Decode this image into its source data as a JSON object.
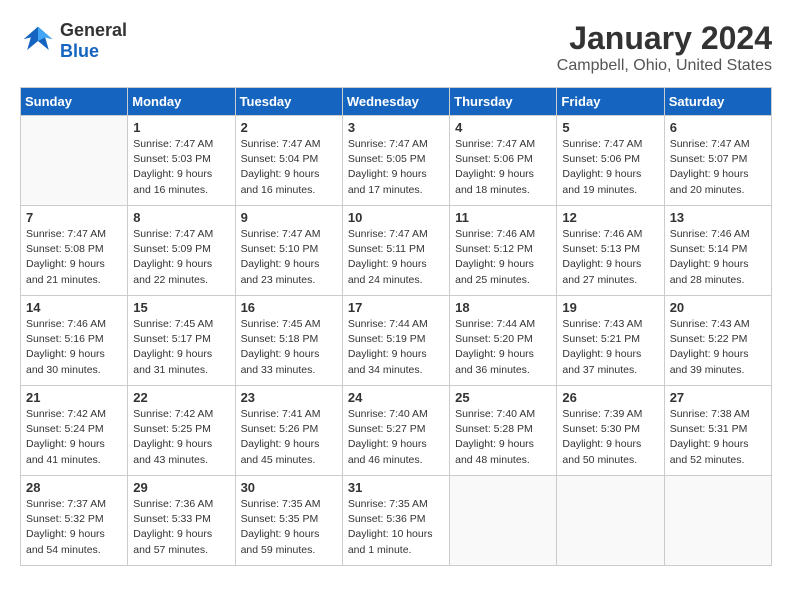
{
  "logo": {
    "line1": "General",
    "line2": "Blue"
  },
  "title": "January 2024",
  "location": "Campbell, Ohio, United States",
  "days_header": [
    "Sunday",
    "Monday",
    "Tuesday",
    "Wednesday",
    "Thursday",
    "Friday",
    "Saturday"
  ],
  "weeks": [
    [
      {
        "day": "",
        "sunrise": "",
        "sunset": "",
        "daylight": ""
      },
      {
        "day": "1",
        "sunrise": "7:47 AM",
        "sunset": "5:03 PM",
        "daylight": "9 hours and 16 minutes."
      },
      {
        "day": "2",
        "sunrise": "7:47 AM",
        "sunset": "5:04 PM",
        "daylight": "9 hours and 16 minutes."
      },
      {
        "day": "3",
        "sunrise": "7:47 AM",
        "sunset": "5:05 PM",
        "daylight": "9 hours and 17 minutes."
      },
      {
        "day": "4",
        "sunrise": "7:47 AM",
        "sunset": "5:06 PM",
        "daylight": "9 hours and 18 minutes."
      },
      {
        "day": "5",
        "sunrise": "7:47 AM",
        "sunset": "5:06 PM",
        "daylight": "9 hours and 19 minutes."
      },
      {
        "day": "6",
        "sunrise": "7:47 AM",
        "sunset": "5:07 PM",
        "daylight": "9 hours and 20 minutes."
      }
    ],
    [
      {
        "day": "7",
        "sunrise": "7:47 AM",
        "sunset": "5:08 PM",
        "daylight": "9 hours and 21 minutes."
      },
      {
        "day": "8",
        "sunrise": "7:47 AM",
        "sunset": "5:09 PM",
        "daylight": "9 hours and 22 minutes."
      },
      {
        "day": "9",
        "sunrise": "7:47 AM",
        "sunset": "5:10 PM",
        "daylight": "9 hours and 23 minutes."
      },
      {
        "day": "10",
        "sunrise": "7:47 AM",
        "sunset": "5:11 PM",
        "daylight": "9 hours and 24 minutes."
      },
      {
        "day": "11",
        "sunrise": "7:46 AM",
        "sunset": "5:12 PM",
        "daylight": "9 hours and 25 minutes."
      },
      {
        "day": "12",
        "sunrise": "7:46 AM",
        "sunset": "5:13 PM",
        "daylight": "9 hours and 27 minutes."
      },
      {
        "day": "13",
        "sunrise": "7:46 AM",
        "sunset": "5:14 PM",
        "daylight": "9 hours and 28 minutes."
      }
    ],
    [
      {
        "day": "14",
        "sunrise": "7:46 AM",
        "sunset": "5:16 PM",
        "daylight": "9 hours and 30 minutes."
      },
      {
        "day": "15",
        "sunrise": "7:45 AM",
        "sunset": "5:17 PM",
        "daylight": "9 hours and 31 minutes."
      },
      {
        "day": "16",
        "sunrise": "7:45 AM",
        "sunset": "5:18 PM",
        "daylight": "9 hours and 33 minutes."
      },
      {
        "day": "17",
        "sunrise": "7:44 AM",
        "sunset": "5:19 PM",
        "daylight": "9 hours and 34 minutes."
      },
      {
        "day": "18",
        "sunrise": "7:44 AM",
        "sunset": "5:20 PM",
        "daylight": "9 hours and 36 minutes."
      },
      {
        "day": "19",
        "sunrise": "7:43 AM",
        "sunset": "5:21 PM",
        "daylight": "9 hours and 37 minutes."
      },
      {
        "day": "20",
        "sunrise": "7:43 AM",
        "sunset": "5:22 PM",
        "daylight": "9 hours and 39 minutes."
      }
    ],
    [
      {
        "day": "21",
        "sunrise": "7:42 AM",
        "sunset": "5:24 PM",
        "daylight": "9 hours and 41 minutes."
      },
      {
        "day": "22",
        "sunrise": "7:42 AM",
        "sunset": "5:25 PM",
        "daylight": "9 hours and 43 minutes."
      },
      {
        "day": "23",
        "sunrise": "7:41 AM",
        "sunset": "5:26 PM",
        "daylight": "9 hours and 45 minutes."
      },
      {
        "day": "24",
        "sunrise": "7:40 AM",
        "sunset": "5:27 PM",
        "daylight": "9 hours and 46 minutes."
      },
      {
        "day": "25",
        "sunrise": "7:40 AM",
        "sunset": "5:28 PM",
        "daylight": "9 hours and 48 minutes."
      },
      {
        "day": "26",
        "sunrise": "7:39 AM",
        "sunset": "5:30 PM",
        "daylight": "9 hours and 50 minutes."
      },
      {
        "day": "27",
        "sunrise": "7:38 AM",
        "sunset": "5:31 PM",
        "daylight": "9 hours and 52 minutes."
      }
    ],
    [
      {
        "day": "28",
        "sunrise": "7:37 AM",
        "sunset": "5:32 PM",
        "daylight": "9 hours and 54 minutes."
      },
      {
        "day": "29",
        "sunrise": "7:36 AM",
        "sunset": "5:33 PM",
        "daylight": "9 hours and 57 minutes."
      },
      {
        "day": "30",
        "sunrise": "7:35 AM",
        "sunset": "5:35 PM",
        "daylight": "9 hours and 59 minutes."
      },
      {
        "day": "31",
        "sunrise": "7:35 AM",
        "sunset": "5:36 PM",
        "daylight": "10 hours and 1 minute."
      },
      {
        "day": "",
        "sunrise": "",
        "sunset": "",
        "daylight": ""
      },
      {
        "day": "",
        "sunrise": "",
        "sunset": "",
        "daylight": ""
      },
      {
        "day": "",
        "sunrise": "",
        "sunset": "",
        "daylight": ""
      }
    ]
  ]
}
